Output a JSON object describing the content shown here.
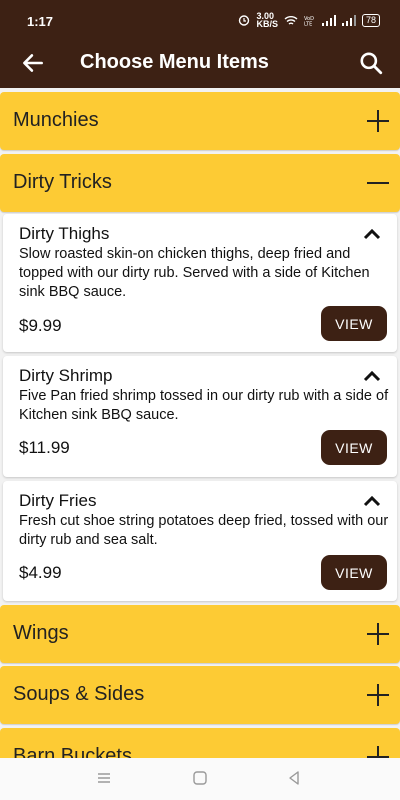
{
  "status": {
    "time": "1:17",
    "net_speed": "3.00\nKB/S",
    "battery": "78"
  },
  "header": {
    "title": "Choose Menu Items"
  },
  "categories": {
    "munchies": "Munchies",
    "dirty_tricks": "Dirty Tricks",
    "wings": "Wings",
    "soups_sides": "Soups & Sides",
    "barn_buckets": "Barn Buckets"
  },
  "items": [
    {
      "name": "Dirty Thighs",
      "description": "Slow roasted skin-on chicken thighs, deep fried and topped with our dirty rub. Served with a side of Kitchen sink BBQ sauce.",
      "price": "$9.99",
      "button": "VIEW"
    },
    {
      "name": "Dirty Shrimp",
      "description": "Five Pan fried shrimp tossed in our dirty rub with a side of Kitchen sink BBQ sauce.",
      "price": "$11.99",
      "button": "VIEW"
    },
    {
      "name": "Dirty Fries",
      "description": "Fresh cut shoe string potatoes deep fried, tossed with our dirty rub and sea salt.",
      "price": "$4.99",
      "button": "VIEW"
    }
  ]
}
